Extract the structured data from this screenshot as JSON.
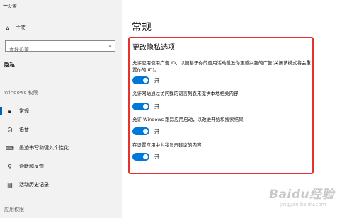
{
  "window": {
    "title": "设置"
  },
  "sidebar": {
    "home_label": "主页",
    "search": {
      "placeholder": "查找设置"
    },
    "current_section": "隐私",
    "windows_permissions_label": "Windows 权限",
    "items": [
      {
        "label": "常规",
        "icon": "lock-icon",
        "active": true
      },
      {
        "label": "语音",
        "icon": "speech-icon",
        "active": false
      },
      {
        "label": "墨迹书写和键入个性化",
        "icon": "pen-keyboard-icon",
        "active": false
      },
      {
        "label": "诊断和反馈",
        "icon": "feedback-icon",
        "active": false
      },
      {
        "label": "活动历史记录",
        "icon": "history-icon",
        "active": false
      }
    ],
    "app_permissions_label": "应用权限"
  },
  "main": {
    "title": "常规",
    "section_title": "更改隐私选项",
    "options": [
      {
        "text": "允许应用使用广告 ID，以便基于你的应用活动投放你更感兴趣的广告(关闭该模式将会重置你的 ID)。",
        "toggle_state": "开",
        "on": true
      },
      {
        "text": "允许网站通过访问我的语言列表来提供本地相关内容",
        "toggle_state": "开",
        "on": true
      },
      {
        "text": "允许 Windows 跟踪应用启动，以改进开始和搜索结果",
        "toggle_state": "开",
        "on": true
      },
      {
        "text": "在设置应用中为我显示建议的内容",
        "toggle_state": "开",
        "on": true
      }
    ],
    "highlight_color": "#e5322d",
    "accent_color": "#0078d7"
  },
  "watermark": {
    "main": "Baidu经验",
    "sub": "jingyan.baidu.com"
  }
}
